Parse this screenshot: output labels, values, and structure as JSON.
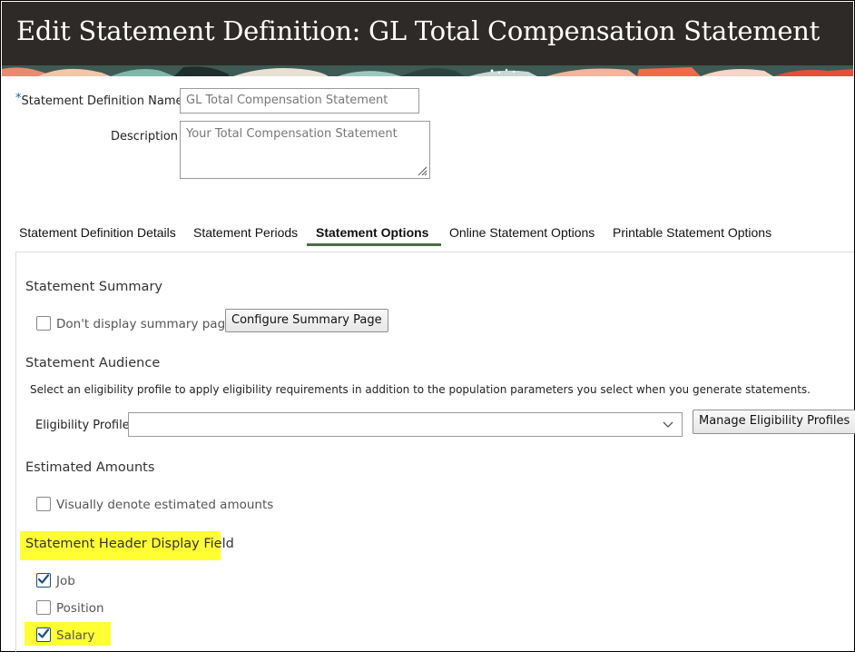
{
  "page_title": "Edit Statement Definition: GL Total Compensation Statement",
  "form": {
    "name_label": "Statement Definition Name",
    "name_required_mark": "*",
    "name_value": "GL Total Compensation Statement",
    "description_label": "Description",
    "description_value": "Your Total Compensation Statement"
  },
  "tabs": [
    {
      "label": "Statement Definition Details",
      "active": false
    },
    {
      "label": "Statement Periods",
      "active": false
    },
    {
      "label": "Statement Options",
      "active": true
    },
    {
      "label": "Online Statement Options",
      "active": false
    },
    {
      "label": "Printable Statement Options",
      "active": false
    }
  ],
  "summary": {
    "heading": "Statement Summary",
    "checkbox_label": "Don't display summary page",
    "checked": false,
    "button_label": "Configure Summary Page"
  },
  "audience": {
    "heading": "Statement Audience",
    "help_text": "Select an eligibility profile to apply eligibility requirements in addition to the population parameters you select when you generate statements.",
    "profile_label": "Eligibility Profile",
    "profile_value": "",
    "manage_button_label": "Manage Eligibility Profiles"
  },
  "estimated": {
    "heading": "Estimated Amounts",
    "checkbox_label": "Visually denote estimated amounts",
    "checked": false
  },
  "header_display": {
    "heading": "Statement Header Display Field",
    "options": [
      {
        "label": "Job",
        "checked": true
      },
      {
        "label": "Position",
        "checked": false
      },
      {
        "label": "Salary",
        "checked": true
      }
    ]
  },
  "colors": {
    "header_bg": "#2e2a27",
    "highlight": "#ffff33",
    "active_tab_underline": "#4e6a47",
    "checkbox_check": "#1a4f86"
  }
}
